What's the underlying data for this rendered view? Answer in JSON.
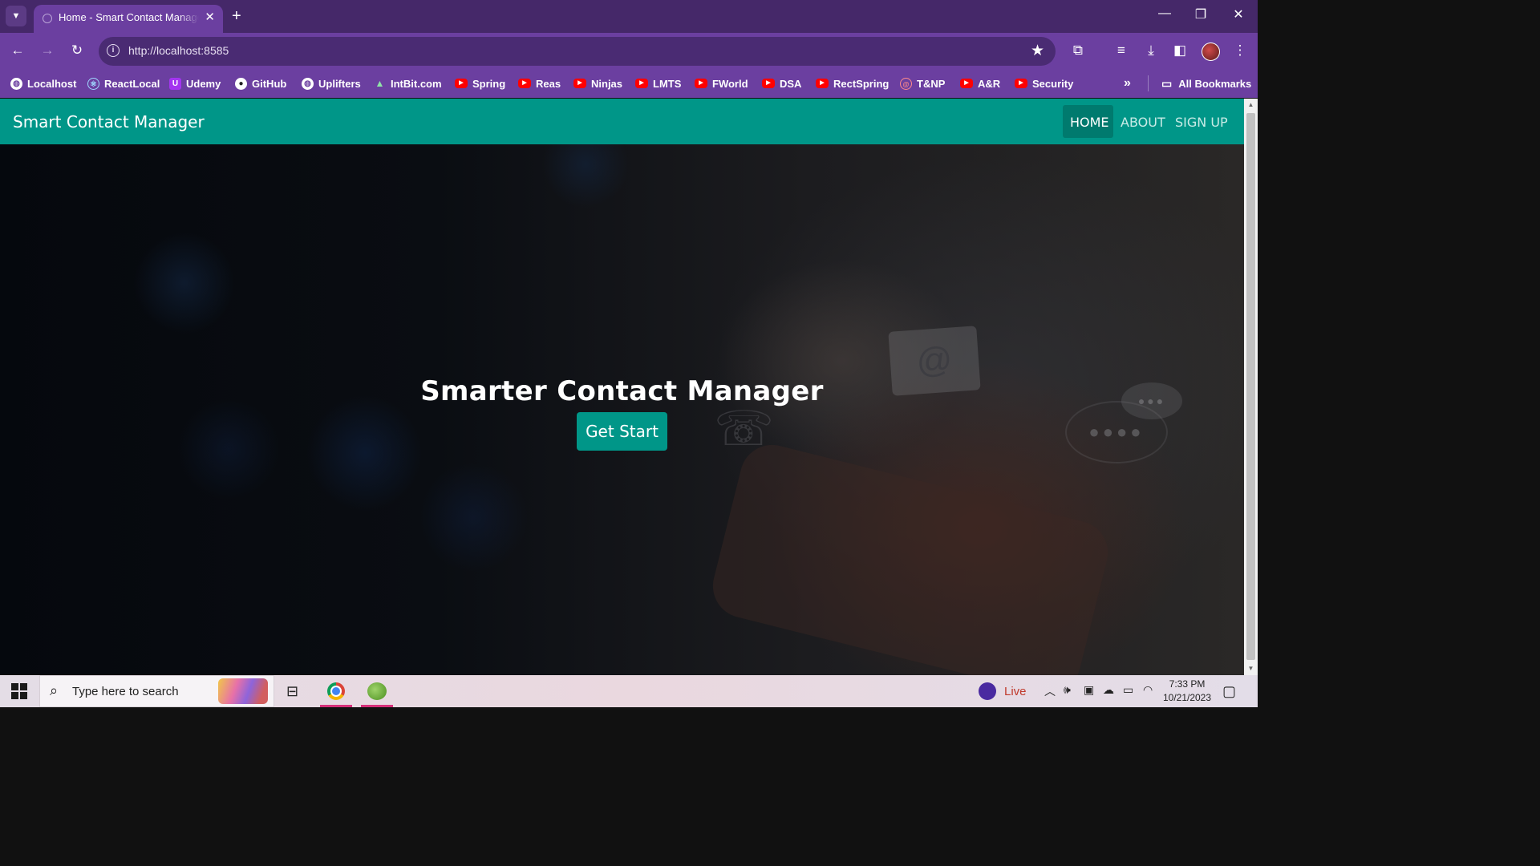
{
  "browser": {
    "tab_title": "Home - Smart Contact Manager",
    "tab_close": "✕",
    "new_tab": "+",
    "url": "http://localhost:8585",
    "bookmarks": [
      {
        "label": "Localhost",
        "icon": "globe-icon"
      },
      {
        "label": "ReactLocal",
        "icon": "react-icon"
      },
      {
        "label": "Udemy",
        "icon": "udemy-icon"
      },
      {
        "label": "GitHub",
        "icon": "github-icon"
      },
      {
        "label": "Uplifters",
        "icon": "globe-icon"
      },
      {
        "label": "IntBit.com",
        "icon": "mountain-icon"
      },
      {
        "label": "Spring",
        "icon": "youtube-icon"
      },
      {
        "label": "Reas",
        "icon": "youtube-icon"
      },
      {
        "label": "Ninjas",
        "icon": "youtube-icon"
      },
      {
        "label": "LMTS",
        "icon": "youtube-icon"
      },
      {
        "label": "FWorld",
        "icon": "youtube-icon"
      },
      {
        "label": "DSA",
        "icon": "youtube-icon"
      },
      {
        "label": "RectSpring",
        "icon": "youtube-icon"
      },
      {
        "label": "T&NP",
        "icon": "tnp-icon"
      },
      {
        "label": "A&R",
        "icon": "youtube-icon"
      },
      {
        "label": "Security",
        "icon": "youtube-icon"
      }
    ],
    "bookmarks_overflow": "»",
    "all_bookmarks": "All Bookmarks"
  },
  "site": {
    "brand": "Smart Contact Manager",
    "nav": {
      "home": "HOME",
      "about": "ABOUT",
      "signup": "SIGN UP"
    },
    "hero_title": "Smarter Contact Manager",
    "hero_button": "Get Start"
  },
  "taskbar": {
    "search_placeholder": "Type here to search",
    "live_label": "Live",
    "time": "7:33 PM",
    "date": "10/21/2023"
  },
  "colors": {
    "browser_frame": "#6b3fa0",
    "tabstrip": "#452869",
    "navbar_teal": "#009688",
    "home_active": "#007a6e"
  }
}
